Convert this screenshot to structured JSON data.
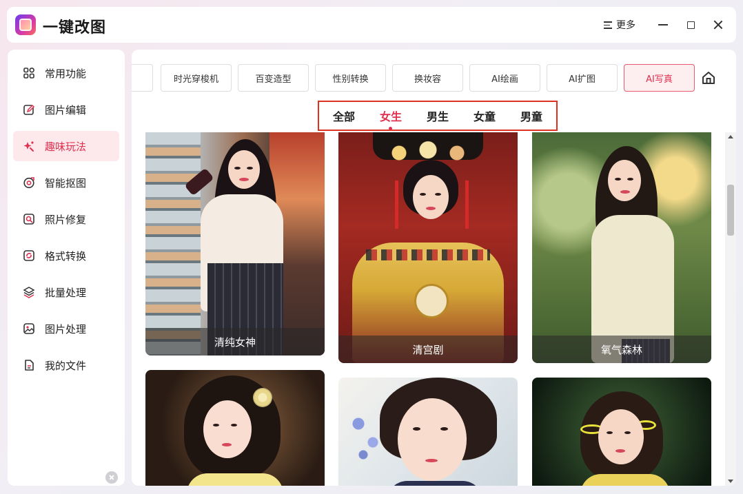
{
  "app": {
    "title": "一键改图"
  },
  "titlebar": {
    "more_label": "更多"
  },
  "sidebar": {
    "items": [
      {
        "label": "常用功能",
        "icon": "grid-icon"
      },
      {
        "label": "图片编辑",
        "icon": "edit-icon"
      },
      {
        "label": "趣味玩法",
        "icon": "sparkle-icon",
        "active": true
      },
      {
        "label": "智能抠图",
        "icon": "target-icon"
      },
      {
        "label": "照片修复",
        "icon": "photo-repair-icon"
      },
      {
        "label": "格式转换",
        "icon": "convert-icon"
      },
      {
        "label": "批量处理",
        "icon": "layers-icon"
      },
      {
        "label": "图片处理",
        "icon": "image-icon"
      },
      {
        "label": "我的文件",
        "icon": "file-icon"
      }
    ]
  },
  "categories": [
    {
      "label": "时光穿梭机"
    },
    {
      "label": "百变造型"
    },
    {
      "label": "性别转换"
    },
    {
      "label": "换妆容"
    },
    {
      "label": "AI绘画"
    },
    {
      "label": "AI扩图"
    },
    {
      "label": "AI写真",
      "active": true
    }
  ],
  "gender_tabs": [
    {
      "label": "全部"
    },
    {
      "label": "女生",
      "active": true
    },
    {
      "label": "男生"
    },
    {
      "label": "女童"
    },
    {
      "label": "男童"
    }
  ],
  "cards": [
    {
      "caption": "清纯女神"
    },
    {
      "caption": "清宫剧"
    },
    {
      "caption": "氧气森林"
    },
    {
      "caption": ""
    },
    {
      "caption": ""
    },
    {
      "caption": ""
    }
  ],
  "colors": {
    "accent": "#e0304e",
    "active_bg": "#fde8ec",
    "highlight_box": "#e0301e"
  }
}
